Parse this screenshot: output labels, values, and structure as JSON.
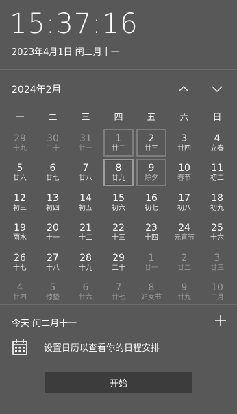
{
  "clock": {
    "time": "15:37:16",
    "date_link": "2023年4月1日 闰二月十一"
  },
  "calendar": {
    "month_title": "2024年2月",
    "nav_up_icon": "chevron-up-icon",
    "nav_down_icon": "chevron-down-icon",
    "weekdays": [
      "一",
      "二",
      "三",
      "四",
      "五",
      "六",
      "日"
    ],
    "weeks": [
      [
        {
          "day": "29",
          "sub": "十九",
          "type": "other"
        },
        {
          "day": "30",
          "sub": "二十",
          "type": "other"
        },
        {
          "day": "31",
          "sub": "廿一",
          "type": "other"
        },
        {
          "day": "1",
          "sub": "廿二",
          "type": "cur"
        },
        {
          "day": "2",
          "sub": "廿三",
          "type": "cur"
        },
        {
          "day": "3",
          "sub": "廿四",
          "type": "cur"
        },
        {
          "day": "4",
          "sub": "立春",
          "type": "cur"
        }
      ],
      [
        {
          "day": "5",
          "sub": "廿六",
          "type": "cur"
        },
        {
          "day": "6",
          "sub": "廿七",
          "type": "cur"
        },
        {
          "day": "7",
          "sub": "廿八",
          "type": "cur"
        },
        {
          "day": "8",
          "sub": "廿九",
          "type": "cur"
        },
        {
          "day": "9",
          "sub": "除夕",
          "type": "cur"
        },
        {
          "day": "10",
          "sub": "春节",
          "type": "cur"
        },
        {
          "day": "11",
          "sub": "初二",
          "type": "cur"
        }
      ],
      [
        {
          "day": "12",
          "sub": "初三",
          "type": "cur"
        },
        {
          "day": "13",
          "sub": "初四",
          "type": "cur"
        },
        {
          "day": "14",
          "sub": "初五",
          "type": "cur"
        },
        {
          "day": "15",
          "sub": "初六",
          "type": "cur"
        },
        {
          "day": "16",
          "sub": "初七",
          "type": "cur"
        },
        {
          "day": "17",
          "sub": "初八",
          "type": "cur"
        },
        {
          "day": "18",
          "sub": "初九",
          "type": "cur"
        }
      ],
      [
        {
          "day": "19",
          "sub": "雨水",
          "type": "cur"
        },
        {
          "day": "20",
          "sub": "十一",
          "type": "cur"
        },
        {
          "day": "21",
          "sub": "十二",
          "type": "cur"
        },
        {
          "day": "22",
          "sub": "十三",
          "type": "cur"
        },
        {
          "day": "23",
          "sub": "十四",
          "type": "cur"
        },
        {
          "day": "24",
          "sub": "元宵节",
          "type": "cur"
        },
        {
          "day": "25",
          "sub": "十六",
          "type": "cur"
        }
      ],
      [
        {
          "day": "26",
          "sub": "十七",
          "type": "cur"
        },
        {
          "day": "27",
          "sub": "十八",
          "type": "cur"
        },
        {
          "day": "28",
          "sub": "十九",
          "type": "cur"
        },
        {
          "day": "29",
          "sub": "二十",
          "type": "cur"
        },
        {
          "day": "1",
          "sub": "廿一",
          "type": "other"
        },
        {
          "day": "2",
          "sub": "廿二",
          "type": "other"
        },
        {
          "day": "3",
          "sub": "廿三",
          "type": "other"
        }
      ],
      [
        {
          "day": "4",
          "sub": "廿四",
          "type": "other"
        },
        {
          "day": "5",
          "sub": "惊蛰",
          "type": "other"
        },
        {
          "day": "6",
          "sub": "廿六",
          "type": "other"
        },
        {
          "day": "7",
          "sub": "廿七",
          "type": "other"
        },
        {
          "day": "8",
          "sub": "妇女节",
          "type": "other"
        },
        {
          "day": "9",
          "sub": "廿九",
          "type": "other"
        },
        {
          "day": "10",
          "sub": "二月",
          "type": "other"
        }
      ]
    ],
    "today_cell": "2024-02-08",
    "lunar_festival_days": [
      "9",
      "10",
      "24"
    ]
  },
  "agenda": {
    "today_label": "今天 闰二月十一",
    "add_icon": "plus-icon",
    "calendar_icon": "calendar-icon",
    "hint": "设置日历以查看你的日程安排",
    "start_button": "开始"
  }
}
